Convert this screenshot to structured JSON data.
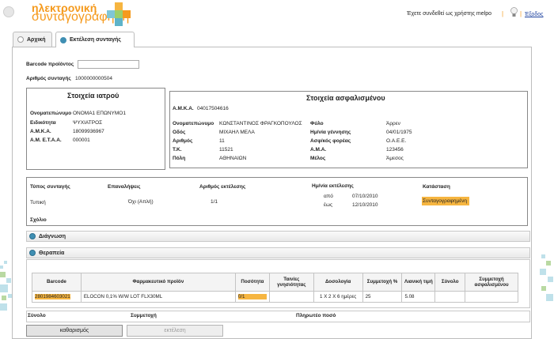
{
  "header": {
    "brand_line1": "ηλεκτρονική",
    "brand_line2": "συνταγογράφηση",
    "logged_in_text": "Έχετε συνδεθεί ως χρήστης melpo",
    "separator": "|",
    "logout_label": "Έξοδος"
  },
  "tabs": [
    {
      "label": "Αρχική",
      "active": false
    },
    {
      "label": "Εκτέλεση συνταγής",
      "active": true
    }
  ],
  "barcode": {
    "label": "Barcode προϊόντος",
    "value": ""
  },
  "prescription_number": {
    "label": "Αριθμός συνταγής",
    "value": "1000000000504"
  },
  "doctor": {
    "title": "Στοιχεία ιατρού",
    "rows": [
      {
        "label": "Ονοματεπώνυμο",
        "value": "ΟΝΟΜΑ1 ΕΠΩΝΥΜΟ1"
      },
      {
        "label": "Ειδικότητα",
        "value": "ΨΥΧΙΑΤΡΟΣ"
      },
      {
        "label": "Α.Μ.Κ.Α.",
        "value": "18099936967"
      },
      {
        "label": "Α.Μ. Ε.Τ.Α.Α.",
        "value": "000001"
      }
    ]
  },
  "insured": {
    "title": "Στοιχεία ασφαλισμένου",
    "amka_label": "Α.Μ.Κ.Α.",
    "amka_value": "04017504616",
    "left_rows": [
      {
        "label": "Ονοματεπώνυμο",
        "value": "ΚΩΝΣΤΑΝΤΙΝΟΣ ΦΡΑΓΚΟΠΟΥΛΟΣ"
      },
      {
        "label": "Οδός",
        "value": "ΜΙΧΑΗΛ ΜΕΛΑ"
      },
      {
        "label": "Αριθμός",
        "value": "11"
      },
      {
        "label": "Τ.Κ.",
        "value": "11521"
      },
      {
        "label": "Πόλη",
        "value": "ΑΘΗΝΑΙΩΝ"
      }
    ],
    "right_rows": [
      {
        "label": "Φύλο",
        "value": "Άρρεν"
      },
      {
        "label": "Ημ/νία γέννησης",
        "value": "04/01/1975"
      },
      {
        "label": "Ασφ/κός φορέας",
        "value": "Ο.Α.Ε.Ε."
      },
      {
        "label": "Α.Μ.Α.",
        "value": "123456"
      },
      {
        "label": "Μέλος",
        "value": "Άμεσος"
      }
    ]
  },
  "prescription": {
    "type_label": "Τύπος συνταγής",
    "type_value": "Τυπική",
    "repeat_label": "Επαναλήψεις",
    "repeat_value": "Όχι (Απλή)",
    "exec_num_label": "Αριθμός εκτέλεσης",
    "exec_num_value": "1/1",
    "exec_date_label": "Ημ/νία εκτέλεσης",
    "from_label": "από",
    "from_value": "07/10/2010",
    "to_label": "έως",
    "to_value": "12/10/2010",
    "status_label": "Κατάσταση",
    "status_value": "Συνταγογραφημένη",
    "comment_label": "Σχόλιο"
  },
  "sections": {
    "diagnosis": "Διάγνωση",
    "therapy": "Θεραπεία"
  },
  "therapy_table": {
    "columns": [
      "Barcode",
      "Φαρμακευτικό προϊόν",
      "Ποσότητα",
      "Ταινίες γνησιότητας",
      "Δοσολογία",
      "Συμμετοχή %",
      "Λιανική τιμή",
      "Σύνολο",
      "Συμμετοχή ασφαλισμένου"
    ],
    "rows": [
      [
        "2801984603021",
        "ELOCON 0,1% W/W LOT FLX30ML",
        "0/1",
        "",
        "1 X 2 X 6 ημέρες",
        "25",
        "5.08",
        "",
        ""
      ]
    ]
  },
  "totals": {
    "total_label": "Σύνολο",
    "participation_label": "Συμμετοχή",
    "payable_label": "Πληρωτέο ποσό"
  },
  "buttons": {
    "clear": "καθαρισμός",
    "execute": "εκτέλεση"
  },
  "colors": {
    "brand_orange": "#f59a1d",
    "highlight": "#f6b540",
    "accent_blue": "#3f8fb3"
  }
}
